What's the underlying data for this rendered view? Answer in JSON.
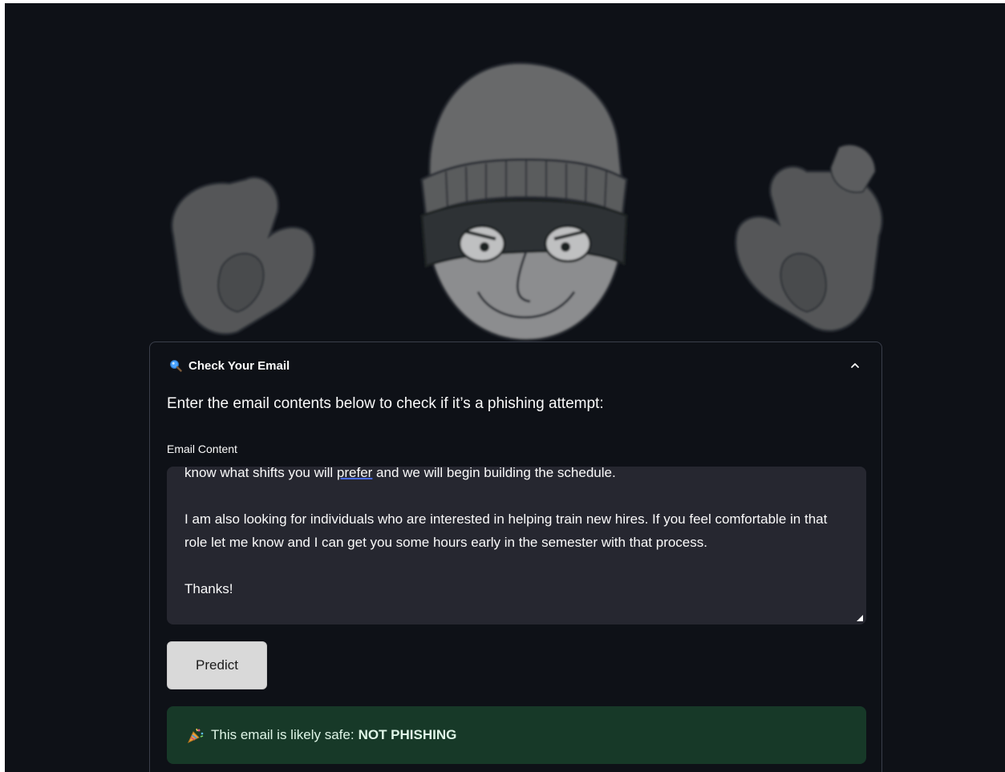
{
  "expander": {
    "title": "Check Your Email",
    "icon": "magnifying-glass-icon",
    "state": "expanded"
  },
  "intro_text": "Enter the email contents below to check if it’s a phishing attempt:",
  "email_field": {
    "label": "Email Content",
    "line_1_pre": "know what shifts you will ",
    "line_1_word": "prefer",
    "line_1_post": " and we will begin building the schedule.",
    "paragraph_2": "I am also looking for individuals who are interested in helping train new hires. If you feel comfortable in that role let me know and I can get you some hours early in the semester with that process.",
    "paragraph_3": "Thanks!"
  },
  "predict_button": {
    "label": "Predict"
  },
  "result": {
    "icon": "party-popper-icon",
    "prefix": "This email is likely safe:",
    "verdict": "NOT PHISHING"
  },
  "colors": {
    "background": "#0e1117",
    "textarea": "#262730",
    "success_bg": "#173928",
    "button_bg": "#d9d9d9"
  }
}
